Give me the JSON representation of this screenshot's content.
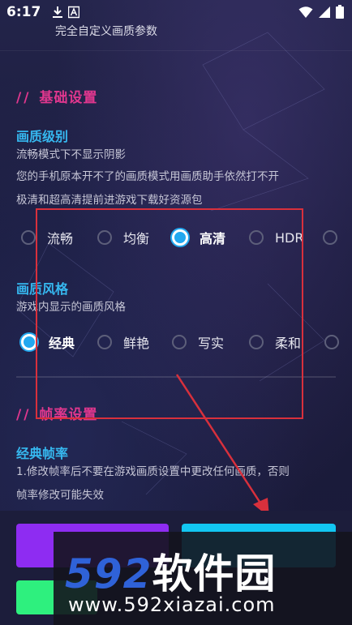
{
  "status_bar": {
    "time": "6:17",
    "left_icons": [
      "download-icon",
      "a-icon"
    ],
    "right_icons": [
      "wifi-icon",
      "signal-icon",
      "battery-icon"
    ]
  },
  "header": {
    "subtitle": "完全自定义画质参数"
  },
  "section_basic": {
    "slashes": "//",
    "title": "基础设置"
  },
  "quality_level": {
    "title": "画质级别",
    "desc1": "流畅模式下不显示阴影",
    "desc2": "您的手机原本开不了的画质模式用画质助手依然打不开",
    "desc3": "极清和超高清提前进游戏下载好资源包",
    "options": [
      {
        "label": "流畅",
        "selected": false
      },
      {
        "label": "均衡",
        "selected": false
      },
      {
        "label": "高清",
        "selected": true
      },
      {
        "label": "HDR",
        "selected": false
      }
    ]
  },
  "quality_style": {
    "title": "画质风格",
    "desc": "游戏内显示的画质风格",
    "options": [
      {
        "label": "经典",
        "selected": true
      },
      {
        "label": "鲜艳",
        "selected": false
      },
      {
        "label": "写实",
        "selected": false
      },
      {
        "label": "柔和",
        "selected": false
      }
    ]
  },
  "section_frame": {
    "slashes": "//",
    "title": "帧率设置"
  },
  "classic_frame": {
    "title": "经典帧率",
    "desc1": "1.修改帧率后不要在游戏画质设置中更改任何画质，否则",
    "desc2": "帧率修改可能失效"
  },
  "watermark": {
    "num": "592",
    "cn": "软件园",
    "url": "www.592xiazai.com"
  },
  "colors": {
    "accent_pink": "#e0378e",
    "accent_blue": "#36b8f0",
    "button_purple": "#8e2cf2",
    "button_cyan": "#12c6f2",
    "button_green": "#2ef07e",
    "highlight_red": "#d8303c"
  }
}
